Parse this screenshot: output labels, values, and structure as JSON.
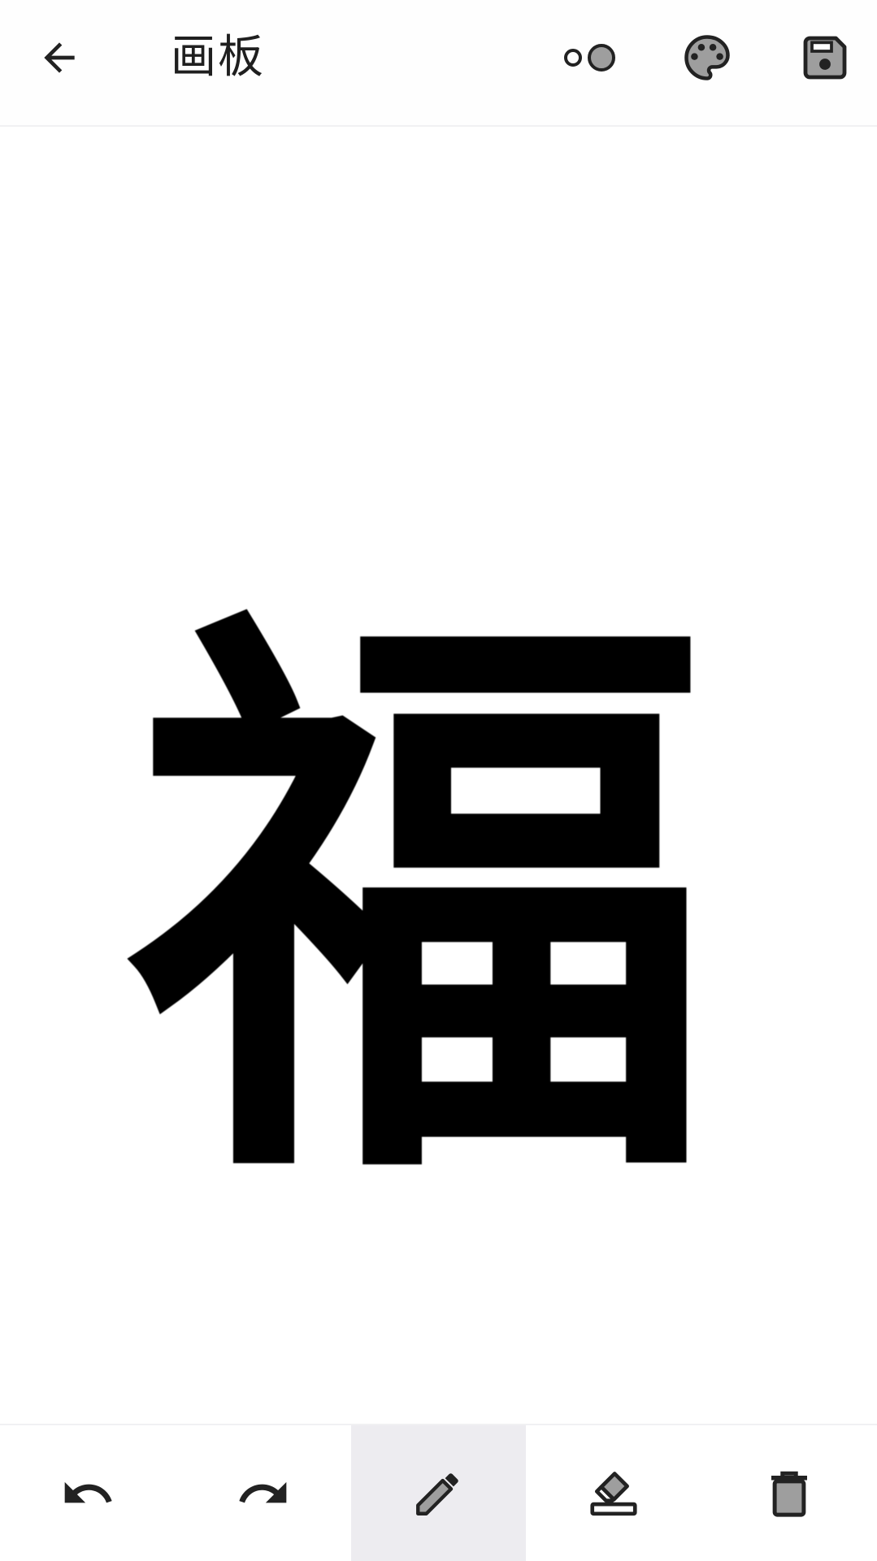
{
  "app": {
    "title": "画板"
  },
  "toolbar": {
    "back_icon": "arrow-left-icon",
    "actions": [
      {
        "name": "brush-size-icon"
      },
      {
        "name": "palette-icon"
      },
      {
        "name": "save-icon"
      }
    ]
  },
  "canvas": {
    "drawing_text": "福"
  },
  "bottom_tools": [
    {
      "name": "undo-icon",
      "active": false
    },
    {
      "name": "redo-icon",
      "active": false
    },
    {
      "name": "pencil-icon",
      "active": true
    },
    {
      "name": "eraser-icon",
      "active": false
    },
    {
      "name": "trash-icon",
      "active": false
    }
  ],
  "colors": {
    "icon": "#222222",
    "active_tool_bg": "#edecf0",
    "divider": "#f1f1f3",
    "ink": "#000000"
  }
}
